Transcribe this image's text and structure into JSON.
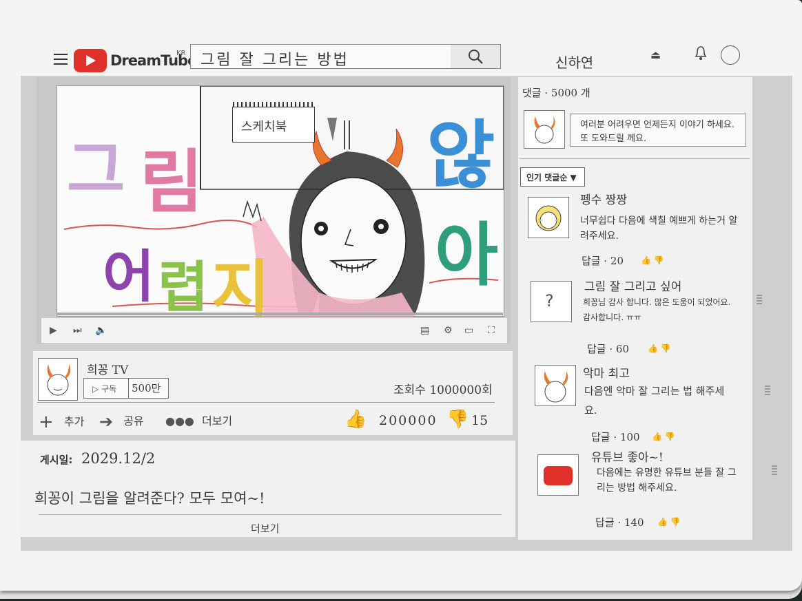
{
  "header": {
    "brand": "DreamTube",
    "region": "KR",
    "search_query": "그림 잘 그리는 방법",
    "user_name": "신하연"
  },
  "video": {
    "title_big": [
      "그",
      "림",
      "어",
      "렵",
      "지",
      "않",
      "아"
    ],
    "sketchbook_label": "스케치북"
  },
  "channel": {
    "name": "희꽁 TV",
    "subscribe_label": "구독",
    "subscriber_count": "500만",
    "views": "조회수 1000000회"
  },
  "actions": {
    "add": "추가",
    "share": "공유",
    "more": "더보기",
    "likes": "200000",
    "dislikes": "15"
  },
  "description": {
    "posted_label": "게시일:",
    "posted_date": "2029.12/2",
    "text": "희꽁이 그림을 알려준다? 모두 모여~!",
    "more": "더보기"
  },
  "comments": {
    "count_label": "댓글 · 5000 개",
    "composer_text": "여러분 어려우면 언제든지 이야기 하세요. 또 도와드릴 께요.",
    "sort_label": "인기 댓글순 ▼",
    "items": [
      {
        "author": "펭수 짱짱",
        "text": "너무쉽다 다음에 색칠 예쁘게 하는거 알려주세요.",
        "replies": "답글 · 20"
      },
      {
        "author": "그림 잘 그리고 싶어",
        "text": "희꽁님 감사 합니다. 많은 도움이 되었어요. 감사합니다. ㅠㅠ",
        "replies": "답글 · 60"
      },
      {
        "author": "악마 최고",
        "text": "다음엔 악마 잘 그리는 법 해주세요.",
        "replies": "답글 · 100"
      },
      {
        "author": "유튜브 좋아~!",
        "text": "다음에는 유명한 유튜브 분들 잘 그리는 방법 해주세요.",
        "replies": "답글 · 140"
      }
    ]
  },
  "colors": {
    "brand_red": "#e0302a",
    "panel": "#f1f1f1",
    "frame": "#cfcfcf"
  }
}
